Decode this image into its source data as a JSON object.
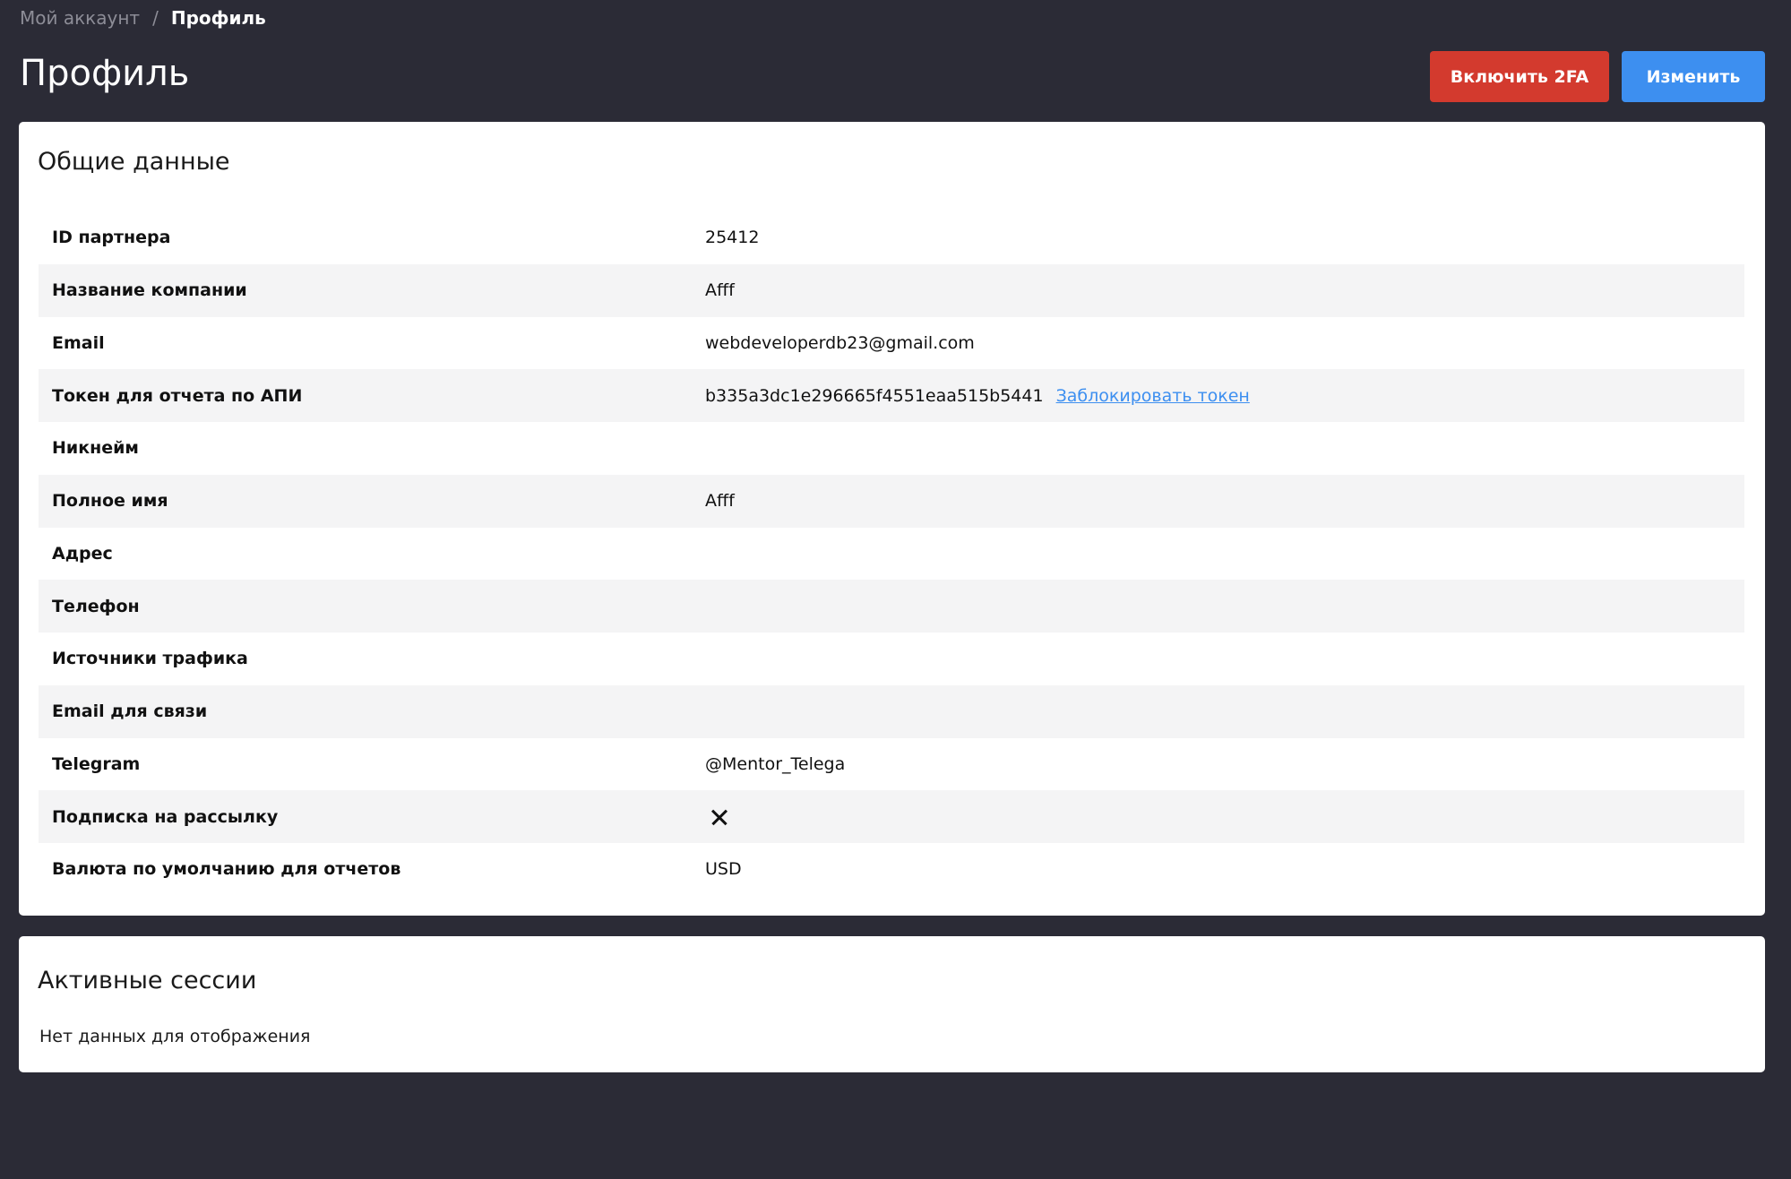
{
  "breadcrumb": {
    "parent": "Мой аккаунт",
    "separator": "/",
    "current": "Профиль"
  },
  "header": {
    "title": "Профиль",
    "enable_2fa_label": "Включить 2FA",
    "edit_label": "Изменить"
  },
  "general": {
    "title": "Общие данные",
    "rows": [
      {
        "label": "ID партнера",
        "value": "25412"
      },
      {
        "label": "Название компании",
        "value": "Afff"
      },
      {
        "label": "Email",
        "value": "webdeveloperdb23@gmail.com"
      },
      {
        "label": "Токен для отчета по АПИ",
        "value": "b335a3dc1e296665f4551eaa515b5441",
        "link": "Заблокировать токен"
      },
      {
        "label": "Никнейм",
        "value": ""
      },
      {
        "label": "Полное имя",
        "value": "Afff"
      },
      {
        "label": "Адрес",
        "value": ""
      },
      {
        "label": "Телефон",
        "value": ""
      },
      {
        "label": "Источники трафика",
        "value": ""
      },
      {
        "label": "Email для связи",
        "value": ""
      },
      {
        "label": "Telegram",
        "value": "@Mentor_Telega"
      },
      {
        "label": "Подписка на рассылку",
        "value": "",
        "icon": "close-icon"
      },
      {
        "label": "Валюта по умолчанию для отчетов",
        "value": "USD"
      }
    ]
  },
  "sessions": {
    "title": "Активные сессии",
    "empty_text": "Нет данных для отображения"
  },
  "colors": {
    "background": "#2b2b36",
    "danger": "#d33a2e",
    "primary": "#3d8ff0",
    "row_alt": "#f4f4f5"
  }
}
